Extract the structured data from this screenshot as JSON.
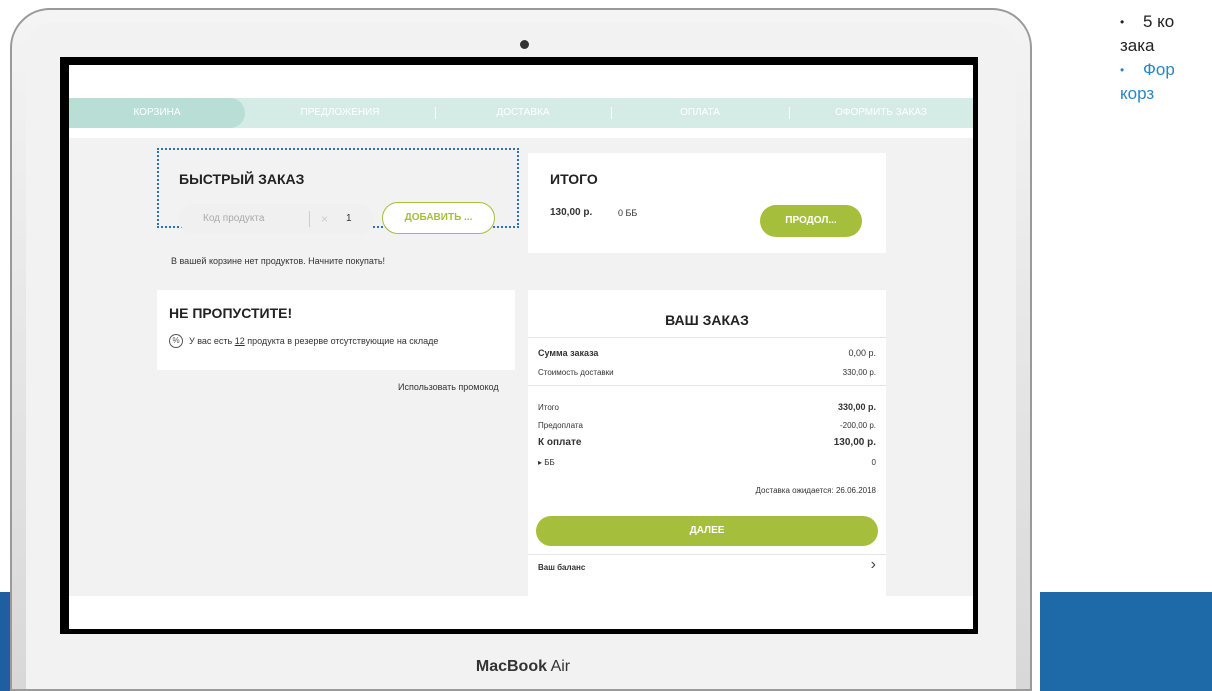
{
  "slide": {
    "bullet1_line1": "5 ко",
    "bullet1_line2": "зака",
    "bullet2_line1": "Фор",
    "bullet2_line2": "корз"
  },
  "device": {
    "brand_bold": "MacBook",
    "brand_light": " Air"
  },
  "nav": {
    "tabs": [
      "КОРЗИНА",
      "ПРЕДЛОЖЕНИЯ",
      "ДОСТАВКА",
      "ОПЛАТА",
      "ОФОРМИТЬ ЗАКАЗ"
    ],
    "active": "КОРЗИНА"
  },
  "quick_order": {
    "title": "БЫСТРЫЙ ЗАКАЗ",
    "code_placeholder": "Код продукта",
    "qty": "1",
    "add_label": "ДОБАВИТЬ ...",
    "empty_message": "В вашей корзине нет продуктов. Начните покупать!"
  },
  "total": {
    "title": "ИТОГО",
    "amount": "130,00 р.",
    "bb": "0 ББ",
    "continue_label": "ПРОДОЛ..."
  },
  "dont_miss": {
    "title": "НЕ ПРОПУСТИТЕ!",
    "text_before": "У вас есть ",
    "count": "12",
    "text_after": " продукта в резерве отсутствующие на складе",
    "promo_link": "Использовать промокод"
  },
  "order": {
    "title": "ВАШ ЗАКАЗ",
    "sum_label": "Сумма заказа",
    "sum_value": "0,00 р.",
    "delivery_label": "Стоимость доставки",
    "delivery_value": "330,00 р.",
    "total_label": "Итого",
    "total_value": "330,00 р.",
    "prepay_label": "Предоплата",
    "prepay_value": "-200,00 р.",
    "to_pay_label": "К оплате",
    "to_pay_value": "130,00 р.",
    "bb_label": "ББ",
    "bb_value": "0",
    "delivery_expected": "Доставка ожидается: 26.06.2018",
    "next_label": "ДАЛЕЕ",
    "balance_label": "Ваш баланс"
  },
  "colors": {
    "accent_green": "#a5bf3c",
    "nav_bg": "#d5ece6",
    "dotted_outline": "#2e6fb0"
  }
}
